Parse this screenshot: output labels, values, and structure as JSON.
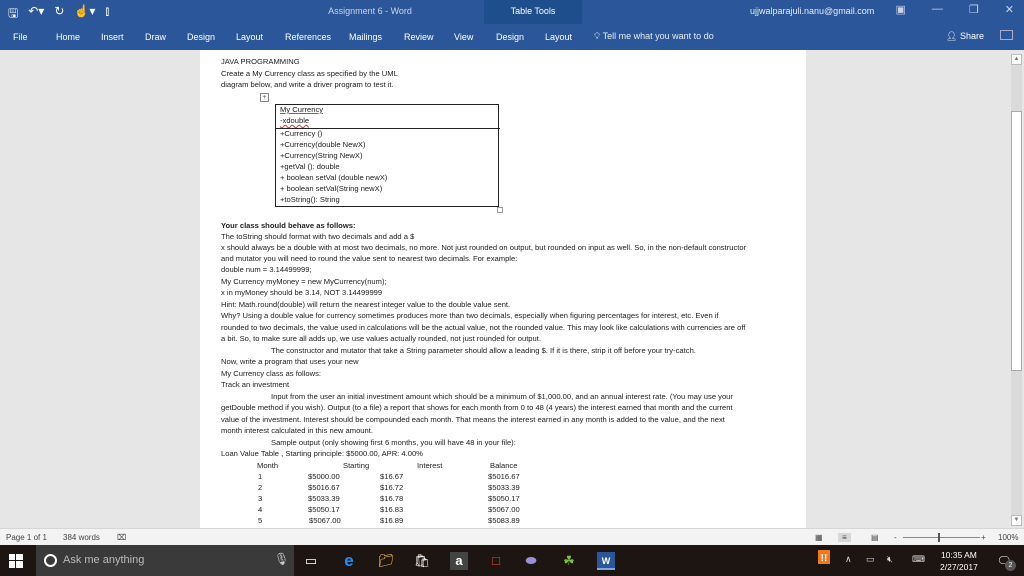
{
  "window": {
    "title": "Assignment 6  -  Word",
    "contextual_group": "Table Tools",
    "account": "ujjwalparajuli.nanu@gmail.com"
  },
  "quick_access": {
    "save_icon": "save-icon",
    "undo_icon": "undo-icon",
    "redo_icon": "redo-icon",
    "touch_icon": "touch-mode-icon",
    "customize_icon": "customize-icon"
  },
  "ribbon": {
    "tabs": [
      "File",
      "Home",
      "Insert",
      "Draw",
      "Design",
      "Layout",
      "References",
      "Mailings",
      "Review",
      "View",
      "Design",
      "Layout"
    ],
    "tell_me": "Tell me what you want to do",
    "share": "Share"
  },
  "document": {
    "heading": "JAVA PROGRAMMING",
    "intro_1": "Create a My Currency class as specified by the UML",
    "intro_2": "diagram below, and write a driver program to test it.",
    "uml": {
      "class_name": "My  Currency",
      "field": "-xdouble",
      "methods": [
        "+Currency ()",
        "+Currency(double NewX)",
        "+Currency(String NewX)",
        "+getVal (): double",
        "+ boolean setVal (double newX)",
        "+ boolean setVal(String newX)",
        "+toString(): String"
      ]
    },
    "lines": [
      "Your class should behave as follows:",
      "The toString should format with two decimals and add a $",
      "x should always be a double with at most two decimals, no more. Not just rounded on output, but rounded on input as well. So, in the non-default constructor",
      "and mutator you will need to round the value sent to nearest two decimals. For example:",
      "double num = 3.14499999;",
      "My Currency myMoney = new MyCurrency(num);",
      "x in myMoney should be 3.14, NOT 3.14499999",
      "Hint: Math.round(double) will return the nearest integer value to the double value sent.",
      "Why? Using a double value for currency sometimes produces more than two decimals, especially when figuring percentages for interest, etc. Even if",
      "rounded to two decimals, the value used in calculations will be the actual value, not the rounded value. This may look like calculations with currencies are off",
      "a bit. So, to make sure all adds up, we use values actually rounded, not just rounded for output.",
      "The constructor and mutator that take a String parameter should allow a leading $. If it is there, strip it off before your try-catch.",
      "Now, write a program that uses your new",
      "My Currency class as follows:",
      "Track an investment",
      "Input from the user an initial investment amount which should be a minimum of $1,000.00, and an annual interest rate. (You may use your",
      "getDouble method if you wish). Output (to a file) a report that shows for each month from 0 to 48 (4 years) the interest earned that month and the current",
      "value of the investment. Interest should be compounded each month. That means the interest earned in any month is added to the value, and the next",
      "month interest calculated in this new amount.",
      "Sample output (only showing first 6 months, you will have 48 in your file):",
      "Loan Value Table , Starting principle: $5000.00, APR: 4.00%"
    ],
    "table": {
      "headers": [
        "Month",
        "Starting",
        "Interest",
        "Balance"
      ],
      "rows": [
        [
          "1",
          "$5000.00",
          "$16.67",
          "$5016.67"
        ],
        [
          "2",
          "$5016.67",
          "$16.72",
          "$5033.39"
        ],
        [
          "3",
          "$5033.39",
          "$16.78",
          "$5050.17"
        ],
        [
          "4",
          "$5050.17",
          "$16.83",
          "$5067.00"
        ],
        [
          "5",
          "$5067.00",
          "$16.89",
          "$5083.89"
        ]
      ]
    }
  },
  "status": {
    "page": "Page 1 of 1",
    "words": "384 words",
    "zoom": "100%",
    "zoom_minus": "-",
    "zoom_plus": "+"
  },
  "taskbar": {
    "search_placeholder": "Ask me anything",
    "time": "10:35 AM",
    "date": "2/27/2017",
    "notifications": "2"
  }
}
